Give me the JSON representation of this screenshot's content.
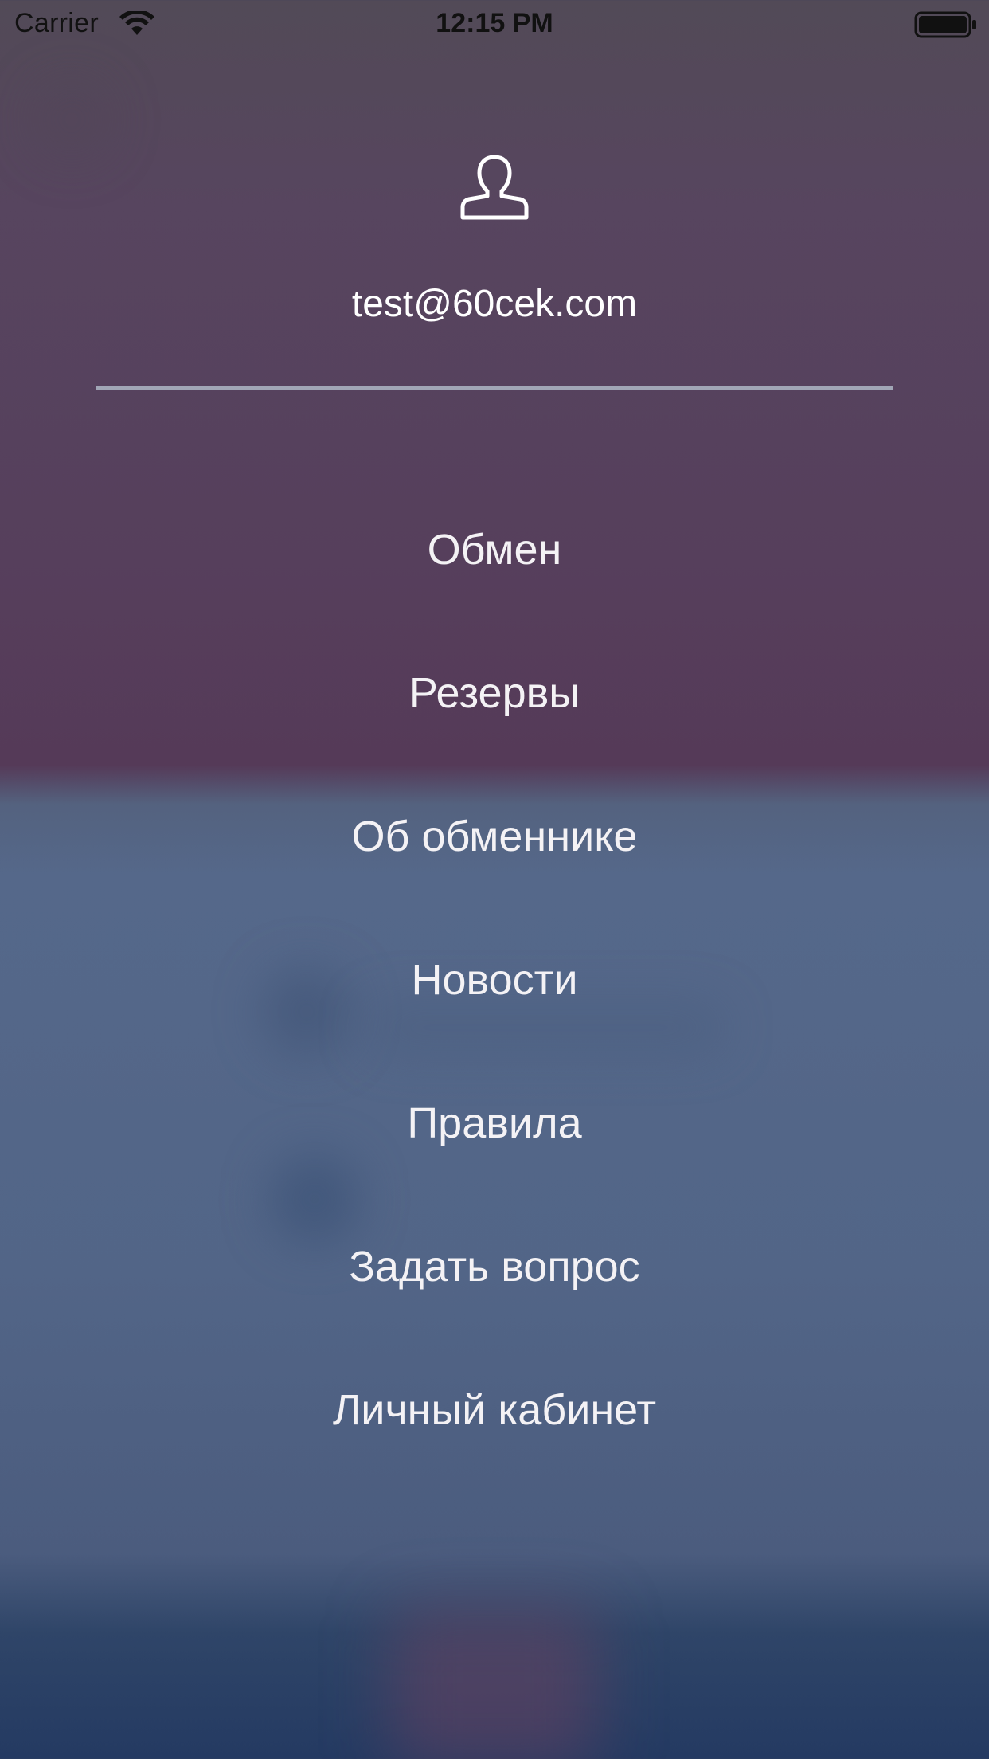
{
  "status_bar": {
    "carrier": "Carrier",
    "time": "12:15 PM"
  },
  "profile": {
    "icon": "user-icon",
    "email": "test@60cek.com"
  },
  "menu": {
    "items": [
      {
        "label": "Обмен"
      },
      {
        "label": "Резервы"
      },
      {
        "label": "Об обменнике"
      },
      {
        "label": "Новости"
      },
      {
        "label": "Правила"
      },
      {
        "label": "Задать вопрос"
      },
      {
        "label": "Личный кабинет"
      }
    ]
  },
  "colors": {
    "text": "#ffffff",
    "divider": "#a1a6b6",
    "top_background": "#564260",
    "bottom_background": "#536686"
  }
}
